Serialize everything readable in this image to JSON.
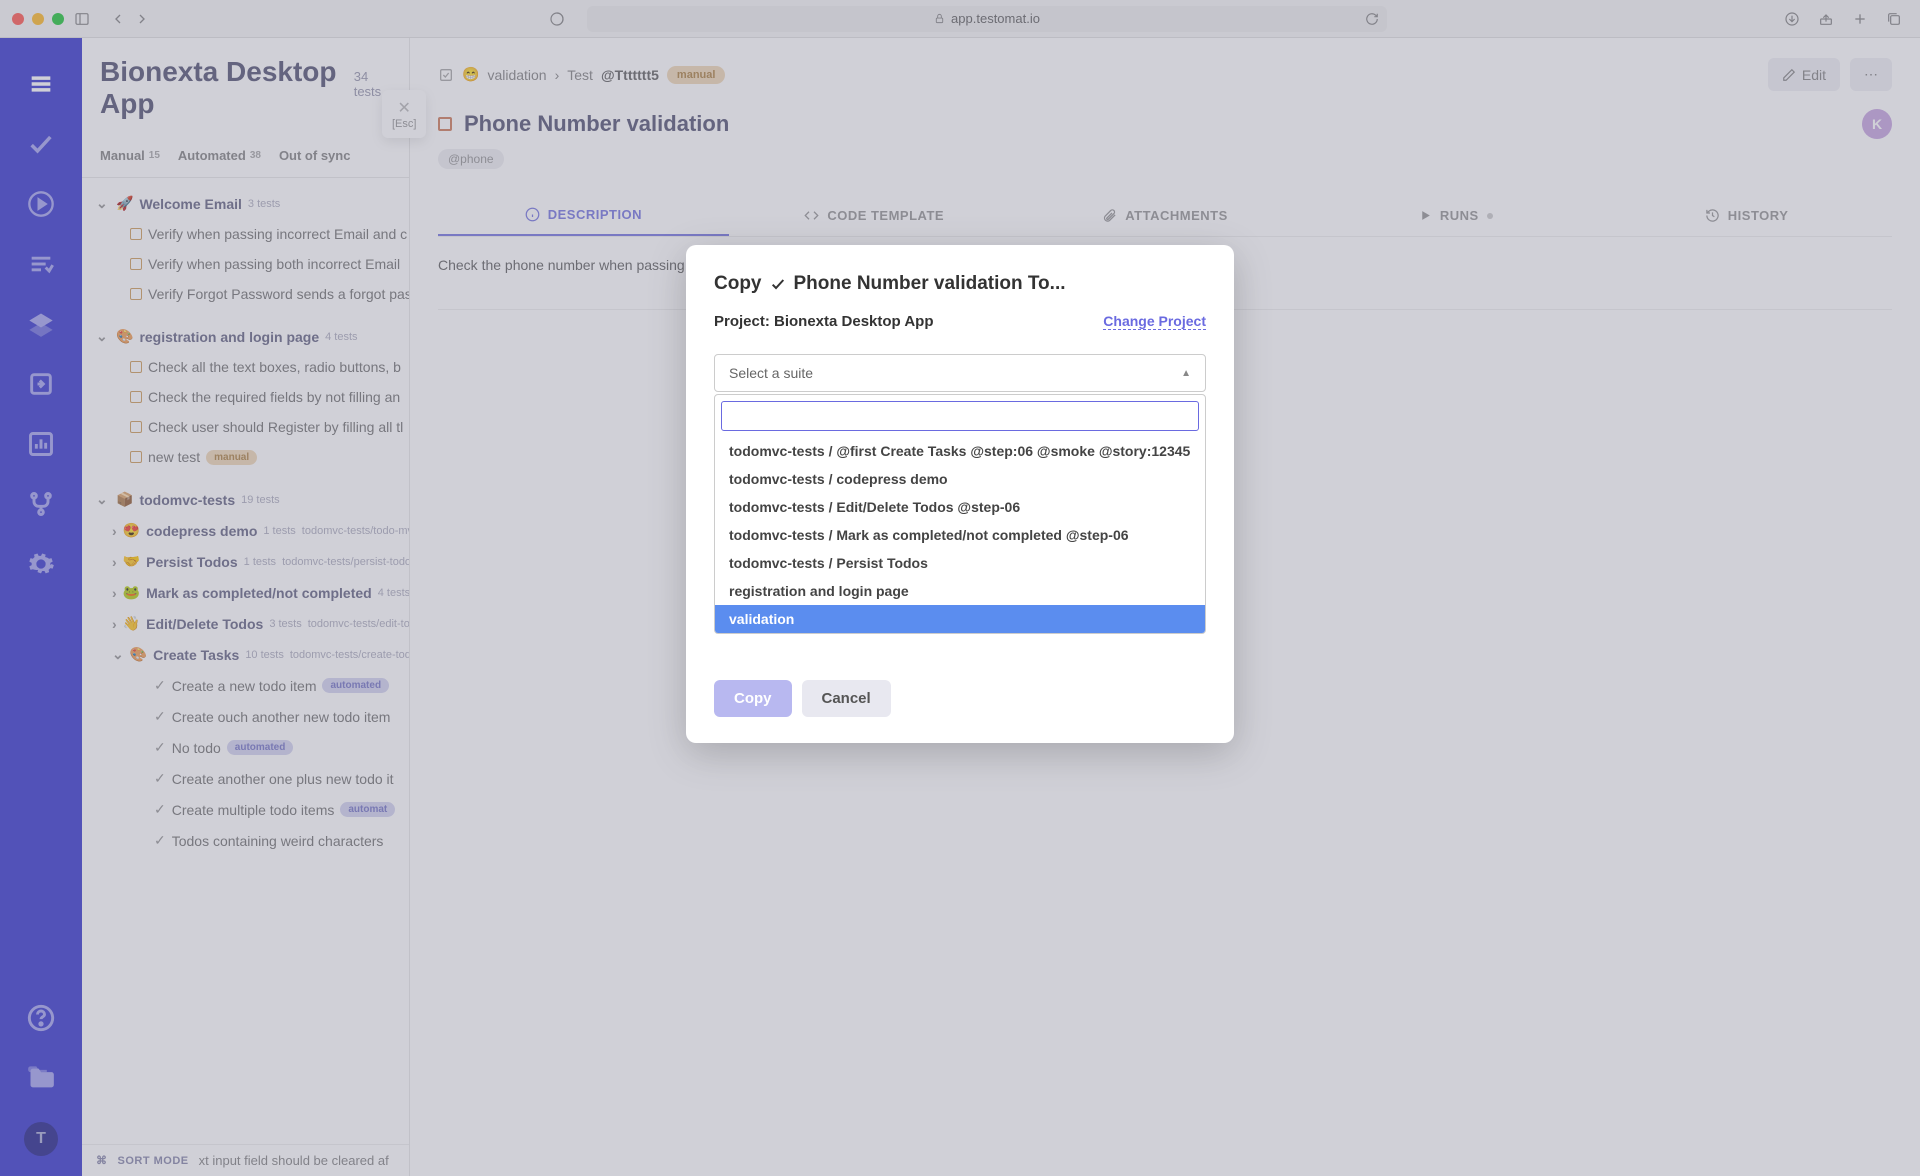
{
  "browser": {
    "url": "app.testomat.io"
  },
  "rail": {
    "avatar_letter": "T"
  },
  "list": {
    "title": "Bionexta Desktop App",
    "count": "34 tests",
    "tabs": {
      "manual_label": "Manual",
      "manual_count": "15",
      "auto_label": "Automated",
      "auto_count": "38",
      "oos_label": "Out of sync"
    },
    "suite1": {
      "name": "Welcome Email",
      "count": "3 tests"
    },
    "suite1_tests": {
      "t1": "Verify when passing incorrect Email and c",
      "t2": "Verify when passing both incorrect Email",
      "t3": "Verify Forgot Password sends a forgot pas"
    },
    "suite2": {
      "name": "registration and login page",
      "count": "4 tests"
    },
    "suite2_tests": {
      "t1": "Check all the text boxes, radio buttons, b",
      "t2": "Check the required fields by not filling an",
      "t3": "Check user should Register by filling all tl",
      "t4": "new test",
      "t4_badge": "manual"
    },
    "suite3": {
      "name": "todomvc-tests",
      "count": "19 tests"
    },
    "sub1": {
      "name": "codepress demo",
      "count": "1 tests",
      "path": "todomvc-tests/todo-mv"
    },
    "sub2": {
      "name": "Persist Todos",
      "count": "1 tests",
      "path": "todomvc-tests/persist-todos"
    },
    "sub3": {
      "name": "Mark as completed/not completed",
      "count": "4 tests"
    },
    "sub4": {
      "name": "Edit/Delete Todos",
      "count": "3 tests",
      "path": "todomvc-tests/edit-to"
    },
    "sub5": {
      "name": "Create Tasks",
      "count": "10 tests",
      "path": "todomvc-tests/create-todos,"
    },
    "sub5_tests": {
      "t1": "Create a new todo item",
      "t1_badge": "automated",
      "t2": "Create ouch another new todo item",
      "t3": "No todo",
      "t3_badge": "automated",
      "t4": "Create another one plus new todo it",
      "t5": "Create multiple todo items",
      "t5_badge": "automat",
      "t6": "Todos containing weird characters"
    },
    "sort_label": "SORT MODE",
    "sort_extra": "xt input field should be cleared af"
  },
  "esc": {
    "label": "[Esc]"
  },
  "detail": {
    "bc_suite": "validation",
    "bc_sep": "›",
    "bc_test": "Test",
    "bc_id": "@Ttttttt5",
    "bc_badge": "manual",
    "edit_label": "Edit",
    "title": "Phone Number validation",
    "tag": "@phone",
    "user_letter": "K",
    "tabs": {
      "desc": "DESCRIPTION",
      "code": "CODE TEMPLATE",
      "attach": "ATTACHMENTS",
      "runs": "RUNS",
      "history": "HISTORY"
    },
    "desc_text": "Check the phone number when passing alphanumeric data"
  },
  "modal": {
    "title_pre": "Copy",
    "title_post": "Phone Number validation To...",
    "project_label": "Project: Bionexta Desktop App",
    "change_label": "Change Project",
    "placeholder": "Select a suite",
    "options": {
      "o1": "todomvc-tests / @first Create Tasks @step:06 @smoke @story:12345",
      "o2": "todomvc-tests / codepress demo",
      "o3": "todomvc-tests / Edit/Delete Todos @step-06",
      "o4": "todomvc-tests / Mark as completed/not completed @step-06",
      "o5": "todomvc-tests / Persist Todos",
      "o6": "registration and login page",
      "o7": "validation"
    },
    "copy_btn": "Copy",
    "cancel_btn": "Cancel"
  }
}
